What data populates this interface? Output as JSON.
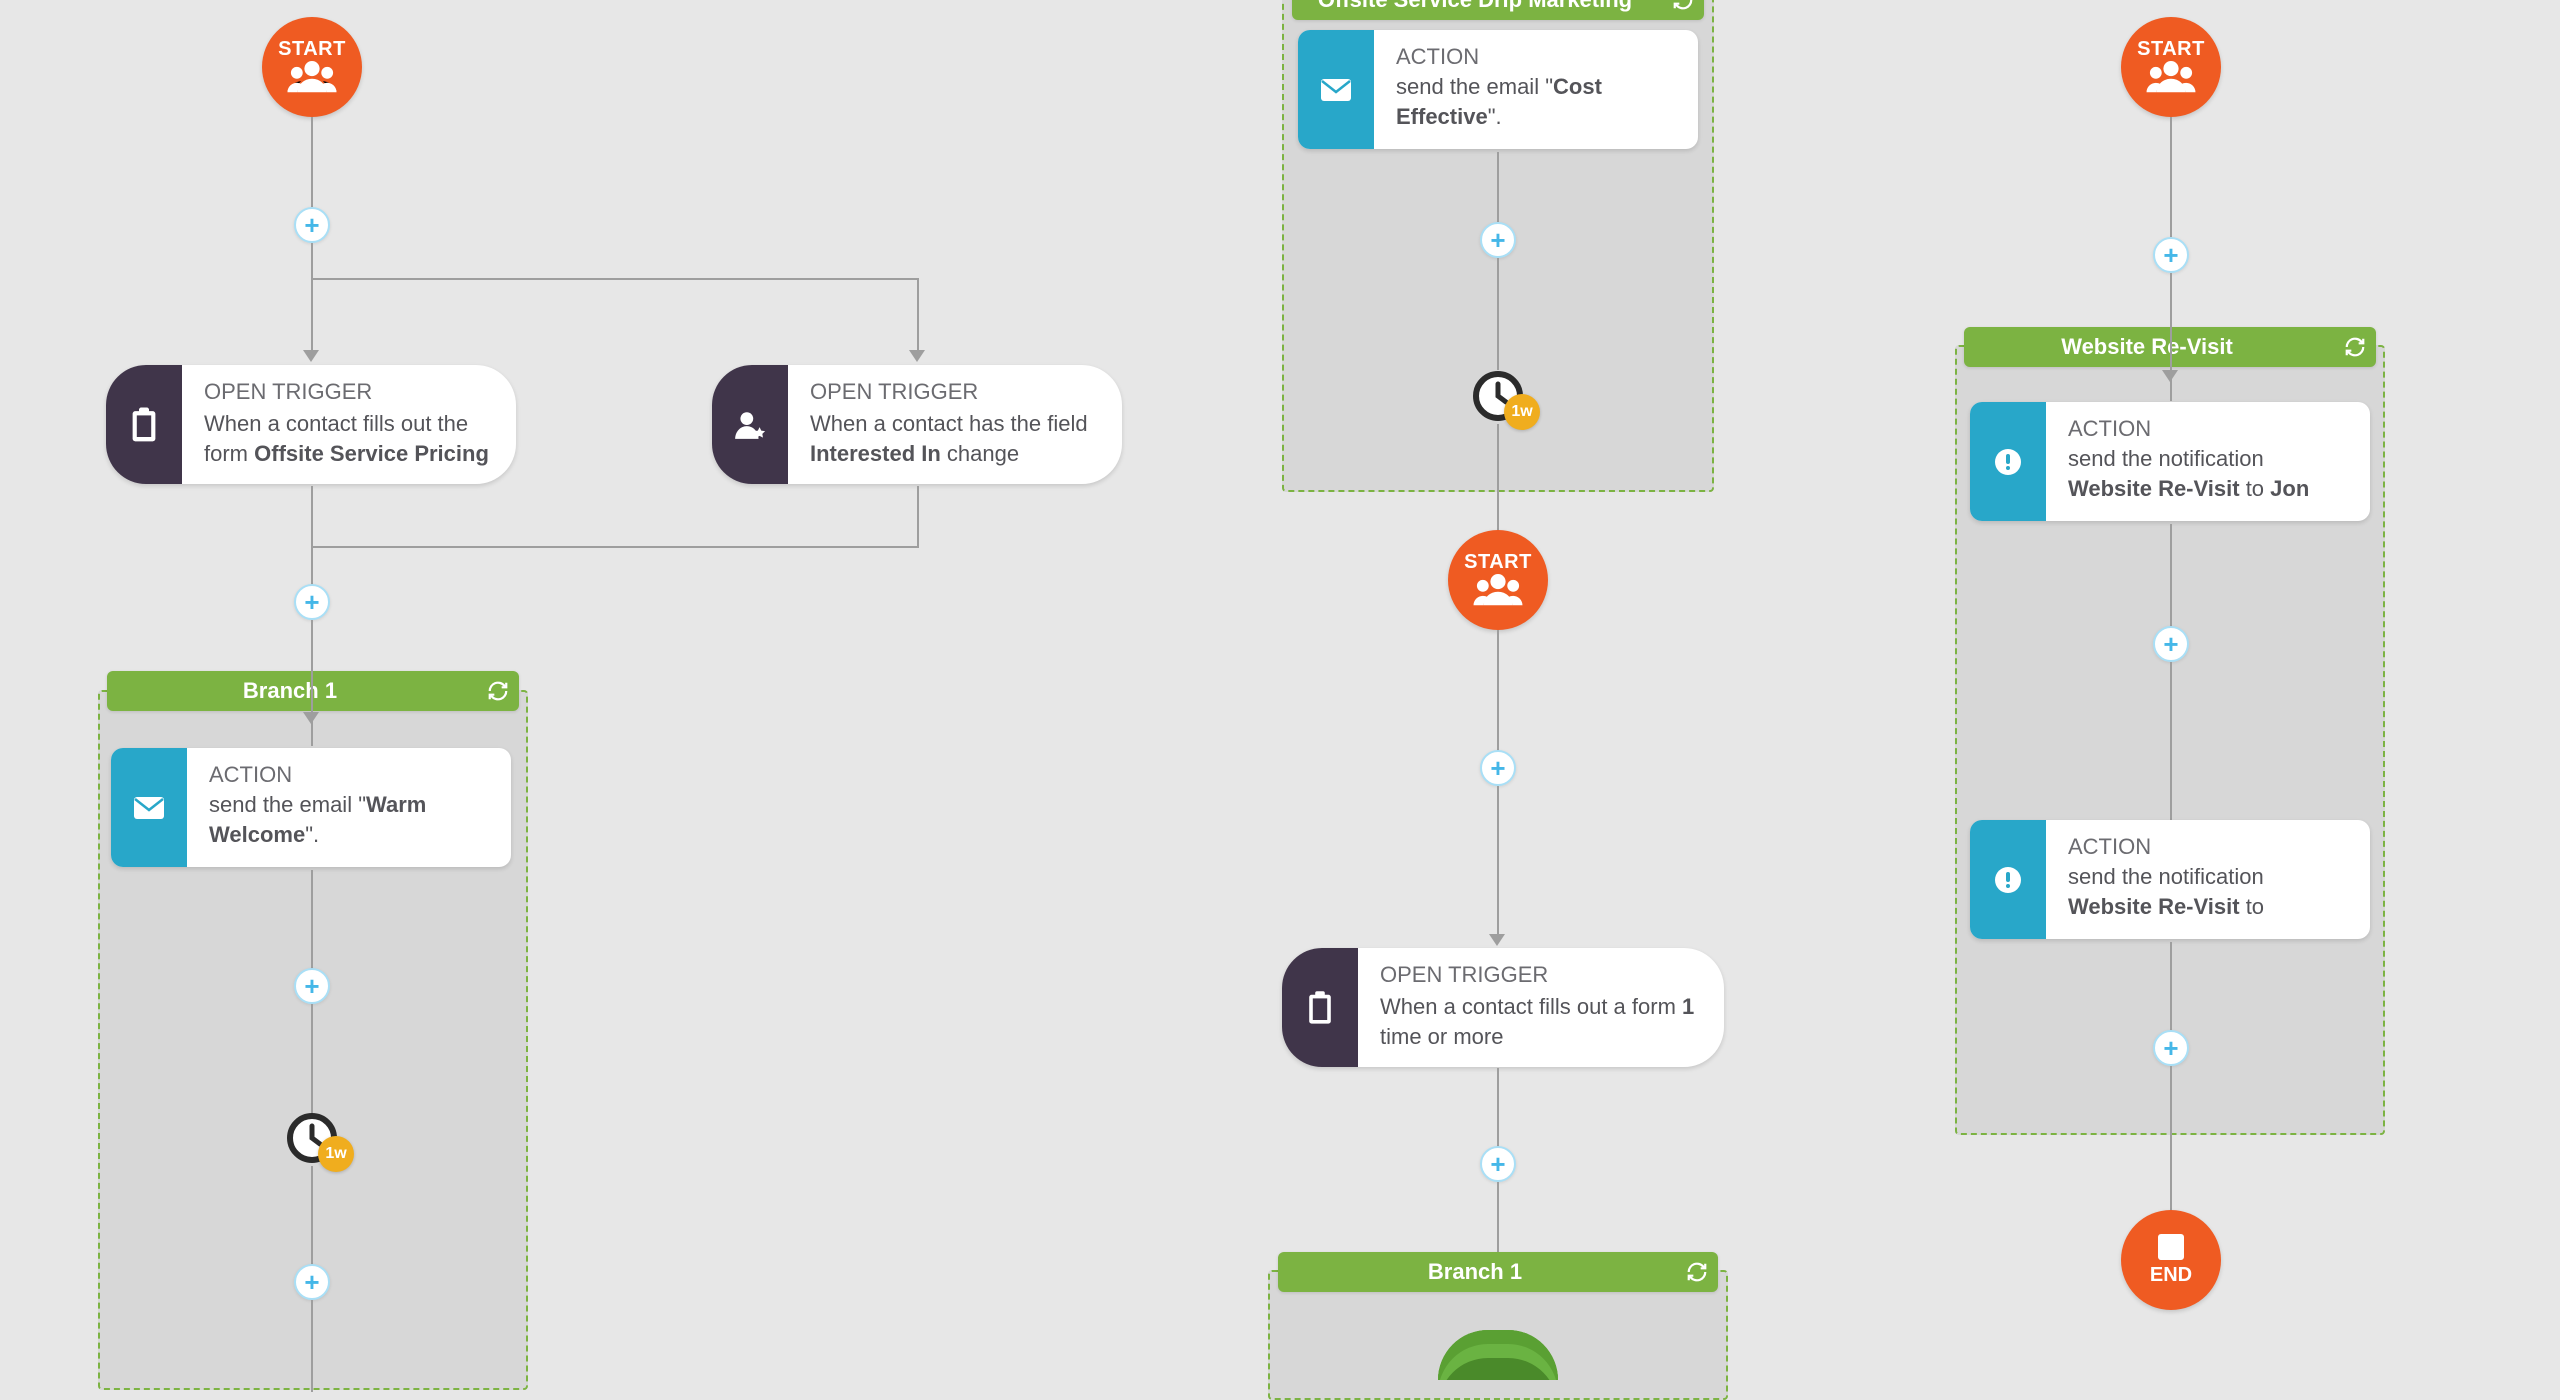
{
  "nodes": {
    "start": "START",
    "end": "END"
  },
  "delay": {
    "one_week": "1w"
  },
  "workflow1": {
    "trigger_form": {
      "title": "OPEN TRIGGER",
      "prefix": "When a contact fills out the form ",
      "bold": "Offsite Service Pricing"
    },
    "trigger_field": {
      "title": "OPEN TRIGGER",
      "prefix": "When a contact has the field ",
      "bold": "Interested In",
      "suffix": " change"
    },
    "branch_label": "Branch 1",
    "action_email": {
      "title": "ACTION",
      "prefix": "send the email \"",
      "bold": "Warm Welcome",
      "suffix": "\"."
    }
  },
  "workflow2": {
    "top_branch_label": "Offsite Service Drip Marketing",
    "action_email": {
      "title": "ACTION",
      "prefix": "send the email \"",
      "bold": "Cost Effective",
      "suffix": "\"."
    },
    "trigger_form": {
      "title": "OPEN TRIGGER",
      "prefix": "When a contact fills out a form ",
      "bold": "1",
      "suffix": " time or more"
    },
    "branch_label": "Branch 1"
  },
  "workflow3": {
    "branch_label": "Website Re-Visit",
    "action_notify_jon": {
      "title": "ACTION",
      "prefix": "send the notification ",
      "bold1": "Website Re-Visit",
      "mid": " to ",
      "bold2": "Jon"
    },
    "action_notify": {
      "title": "ACTION",
      "prefix": "send the notification ",
      "bold": "Website Re-Visit",
      "suffix": " to"
    }
  }
}
